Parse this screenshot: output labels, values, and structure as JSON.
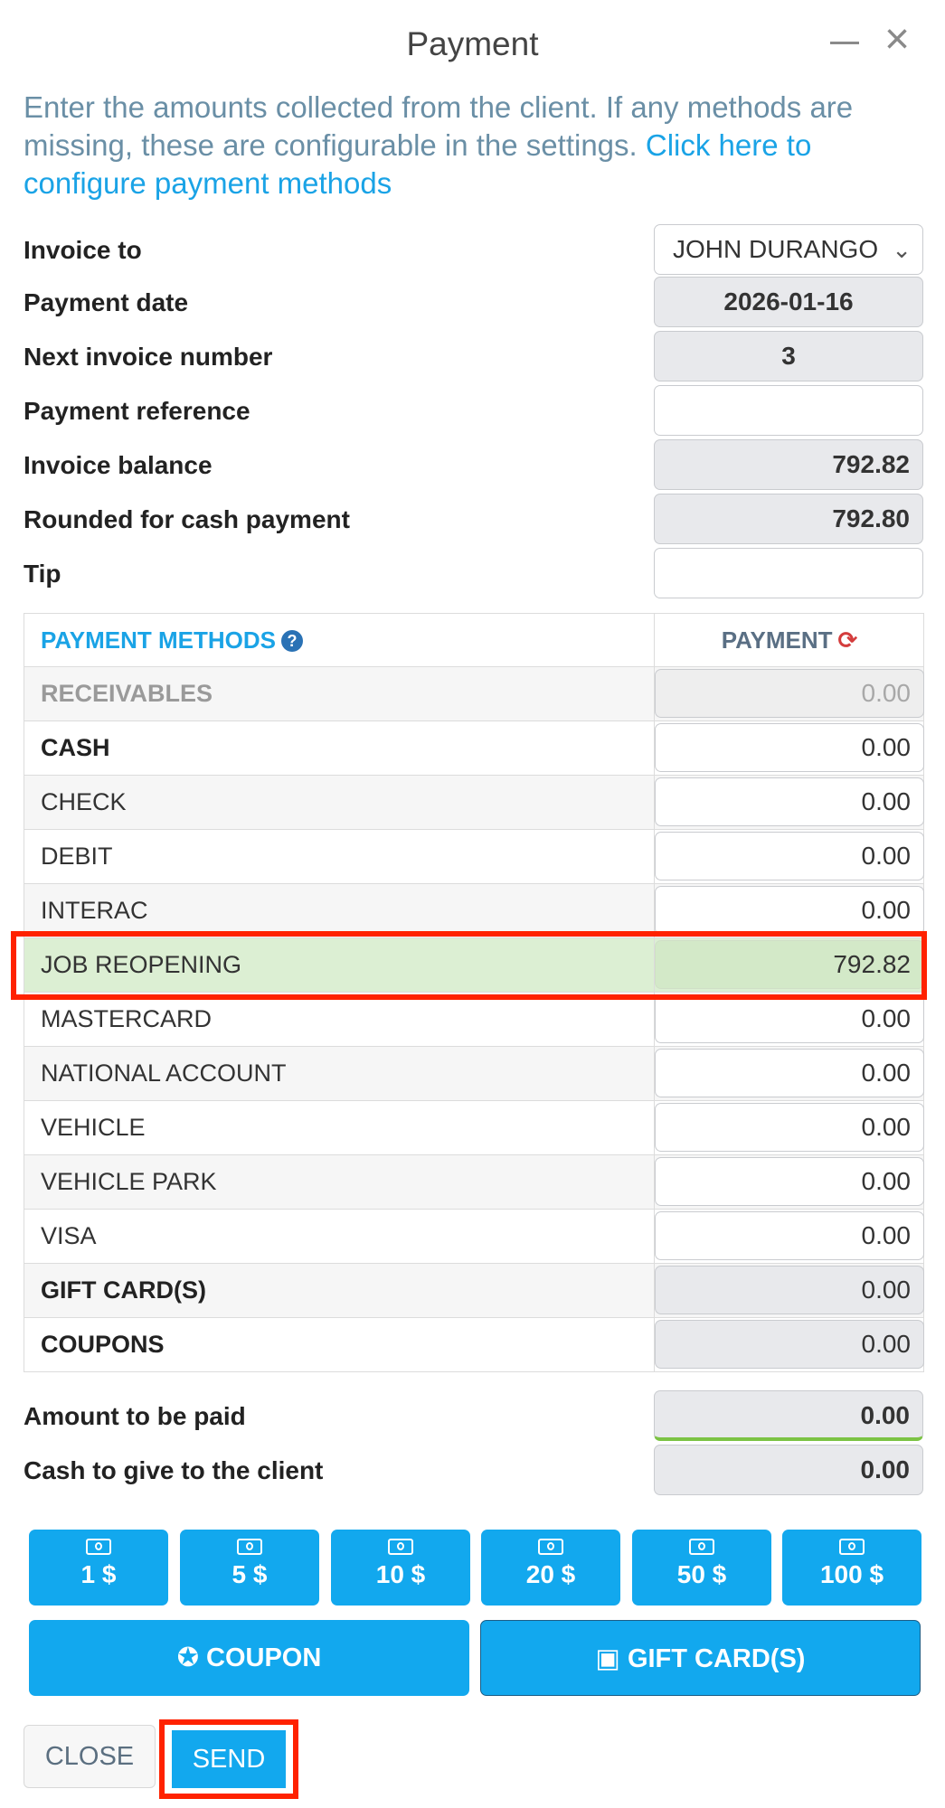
{
  "header": {
    "title": "Payment",
    "minimize_icon": "minimize-icon",
    "close_icon": "close-icon"
  },
  "intro": {
    "text": "Enter the amounts collected from the client. If any methods are missing, these are configurable in the settings. ",
    "link": "Click here to configure payment methods"
  },
  "form": {
    "invoice_to": {
      "label": "Invoice to",
      "value": "JOHN DURANGO"
    },
    "payment_date": {
      "label": "Payment date",
      "value": "2026-01-16"
    },
    "next_invoice": {
      "label": "Next invoice number",
      "value": "3"
    },
    "payment_reference": {
      "label": "Payment reference",
      "value": ""
    },
    "invoice_balance": {
      "label": "Invoice balance",
      "value": "792.82"
    },
    "rounded": {
      "label": "Rounded for cash payment",
      "value": "792.80"
    },
    "tip": {
      "label": "Tip",
      "value": ""
    }
  },
  "table": {
    "header_methods": "PAYMENT METHODS",
    "header_payment": "PAYMENT",
    "rows": [
      {
        "name": "RECEIVABLES",
        "value": "0.00"
      },
      {
        "name": "CASH",
        "value": "0.00"
      },
      {
        "name": "CHECK",
        "value": "0.00"
      },
      {
        "name": "DEBIT",
        "value": "0.00"
      },
      {
        "name": "INTERAC",
        "value": "0.00"
      },
      {
        "name": "JOB REOPENING",
        "value": "792.82"
      },
      {
        "name": "MASTERCARD",
        "value": "0.00"
      },
      {
        "name": "NATIONAL ACCOUNT",
        "value": "0.00"
      },
      {
        "name": "VEHICLE",
        "value": "0.00"
      },
      {
        "name": "VEHICLE PARK",
        "value": "0.00"
      },
      {
        "name": "VISA",
        "value": "0.00"
      },
      {
        "name": "GIFT CARD(S)",
        "value": "0.00"
      },
      {
        "name": "COUPONS",
        "value": "0.00"
      }
    ]
  },
  "summary": {
    "amount_to_pay": {
      "label": "Amount to be paid",
      "value": "0.00"
    },
    "cash_to_give": {
      "label": "Cash to give to the client",
      "value": "0.00"
    }
  },
  "cash_buttons": [
    "1 $",
    "5 $",
    "10 $",
    "20 $",
    "50 $",
    "100 $"
  ],
  "actions": {
    "coupon": "COUPON",
    "gift_card": "GIFT CARD(S)",
    "close": "CLOSE",
    "send": "SEND"
  },
  "colors": {
    "accent": "#12a8ee",
    "highlight_row": "#dcefd3",
    "annotation": "#ff2200",
    "link": "#1aa3e6"
  }
}
